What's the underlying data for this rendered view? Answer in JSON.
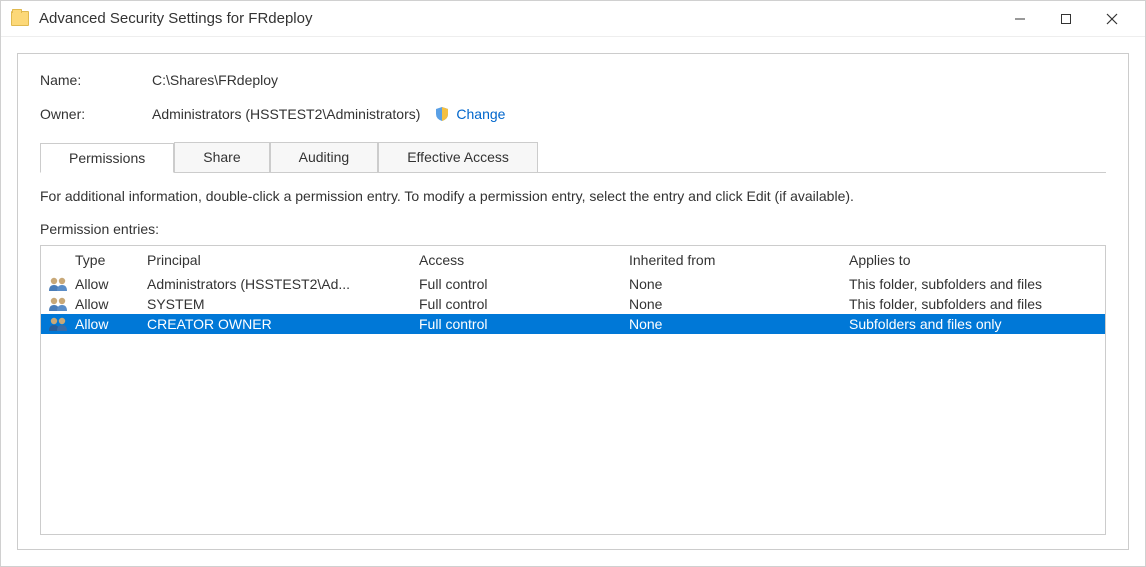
{
  "window_title": "Advanced Security Settings for FRdeploy",
  "name_label": "Name:",
  "name_value": "C:\\Shares\\FRdeploy",
  "owner_label": "Owner:",
  "owner_value": "Administrators (HSSTEST2\\Administrators)",
  "change_link": "Change",
  "tabs": {
    "permissions": "Permissions",
    "share": "Share",
    "auditing": "Auditing",
    "effective": "Effective Access"
  },
  "info_text": "For additional information, double-click a permission entry. To modify a permission entry, select the entry and click Edit (if available).",
  "entries_label": "Permission entries:",
  "table_headers": {
    "type": "Type",
    "principal": "Principal",
    "access": "Access",
    "inherited": "Inherited from",
    "applies": "Applies to"
  },
  "rows": [
    {
      "type": "Allow",
      "principal": "Administrators (HSSTEST2\\Ad...",
      "access": "Full control",
      "inherited": "None",
      "applies": "This folder, subfolders and files"
    },
    {
      "type": "Allow",
      "principal": "SYSTEM",
      "access": "Full control",
      "inherited": "None",
      "applies": "This folder, subfolders and files"
    },
    {
      "type": "Allow",
      "principal": "CREATOR OWNER",
      "access": "Full control",
      "inherited": "None",
      "applies": "Subfolders and files only"
    }
  ]
}
